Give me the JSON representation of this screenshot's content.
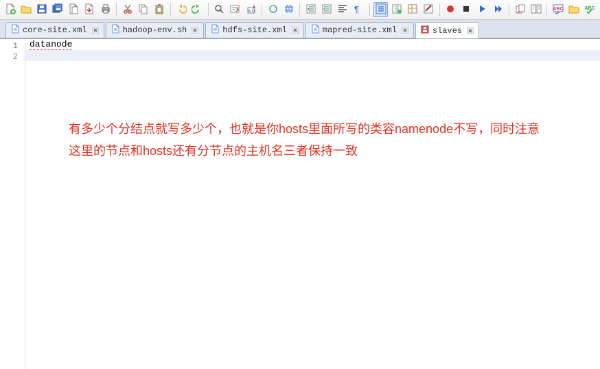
{
  "toolbar": {
    "buttons": [
      "new-file",
      "open-file",
      "save",
      "save-all",
      "copy-file",
      "import",
      "print",
      "sep",
      "cut",
      "copy",
      "paste",
      "sep",
      "undo",
      "redo",
      "sep",
      "find",
      "goto",
      "toggle-bookmark",
      "sep",
      "refresh",
      "link",
      "sep",
      "outdent",
      "indent",
      "align-left",
      "paragraph",
      "sep",
      "list",
      "toggle-whitespace",
      "toggle-grid",
      "edit-flag",
      "sep",
      "record-macro",
      "stop-macro",
      "play-macro",
      "play-fast",
      "sep",
      "duplicate",
      "compare",
      "sep",
      "spellcheck",
      "folder",
      "spellcheck-green"
    ]
  },
  "tabs": [
    {
      "label": "core-site.xml",
      "active": false,
      "dirty": false
    },
    {
      "label": "hadoop-env.sh",
      "active": false,
      "dirty": false
    },
    {
      "label": "hdfs-site.xml",
      "active": false,
      "dirty": false
    },
    {
      "label": "mapred-site.xml",
      "active": false,
      "dirty": false
    },
    {
      "label": "slaves",
      "active": true,
      "dirty": true
    }
  ],
  "editor": {
    "lines": [
      {
        "n": 1,
        "text": "datanode",
        "squiggle": true
      },
      {
        "n": 2,
        "text": "",
        "current": true
      }
    ]
  },
  "annotation": {
    "text": "有多少个分结点就写多少个，也就是你hosts里面所写的类容namenode不写，同时注意这里的节点和hosts还有分节点的主机名三者保持一致"
  }
}
